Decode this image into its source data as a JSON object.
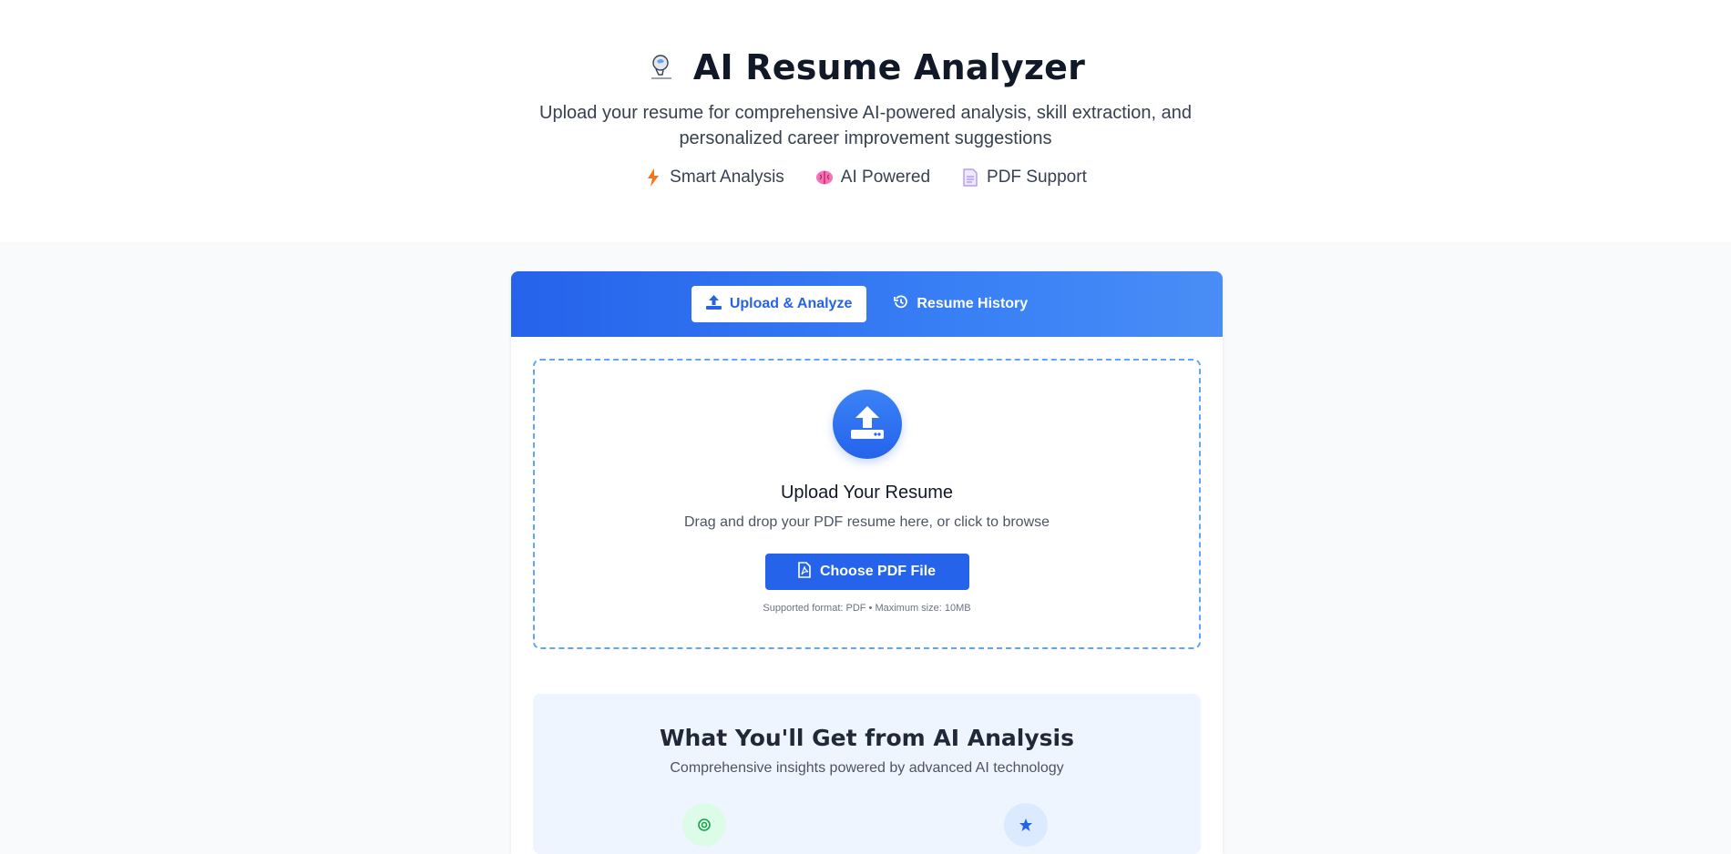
{
  "header": {
    "title": "AI Resume Analyzer",
    "subtitle": "Upload your resume for comprehensive AI-powered analysis, skill extraction, and personalized career improvement suggestions",
    "logo_icon": "brain-head-icon",
    "features": [
      {
        "label": "Smart Analysis",
        "icon": "lightning-icon",
        "color": "#f97316"
      },
      {
        "label": "AI Powered",
        "icon": "brain-icon",
        "color": "#ec4899"
      },
      {
        "label": "PDF Support",
        "icon": "document-icon",
        "color": "#a78bfa"
      }
    ]
  },
  "tabs": [
    {
      "label": "Upload & Analyze",
      "icon": "upload-icon",
      "active": true
    },
    {
      "label": "Resume History",
      "icon": "history-icon",
      "active": false
    }
  ],
  "dropzone": {
    "title": "Upload Your Resume",
    "description": "Drag and drop your PDF resume here, or click to browse",
    "button_label": "Choose PDF File",
    "note": "Supported format: PDF • Maximum size: 10MB"
  },
  "info": {
    "title": "What You'll Get from AI Analysis",
    "subtitle": "Comprehensive insights powered by advanced AI technology"
  },
  "colors": {
    "primary": "#2563eb",
    "primary_light": "#3b82f6",
    "dashed_border": "#60a5fa",
    "info_bg": "#eef5ff"
  }
}
